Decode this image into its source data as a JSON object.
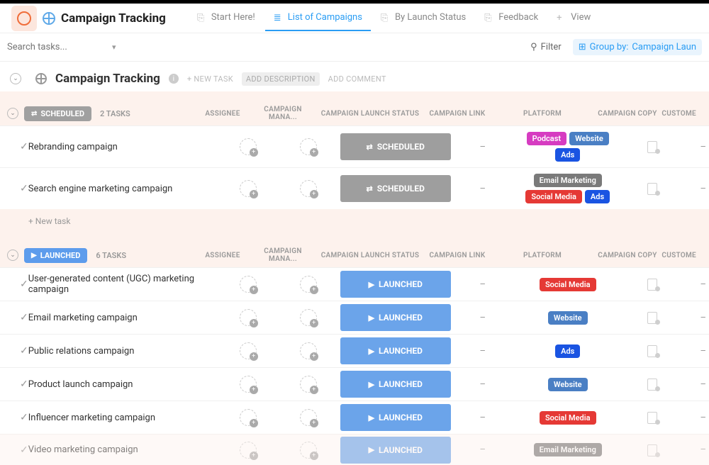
{
  "header": {
    "title": "Campaign Tracking",
    "tabs": [
      {
        "label": "Start Here!"
      },
      {
        "label": "List of Campaigns",
        "active": true
      },
      {
        "label": "By Launch Status"
      },
      {
        "label": "Feedback"
      },
      {
        "label": "View",
        "prefix": "+"
      }
    ]
  },
  "search": {
    "placeholder": "Search tasks..."
  },
  "toolbar": {
    "filter": "Filter",
    "groupByLabel": "Group by:",
    "groupByValue": "Campaign Laun"
  },
  "breadcrumb": {
    "title": "Campaign Tracking",
    "newTask": "+ NEW TASK",
    "addDesc": "ADD DESCRIPTION",
    "addComment": "ADD COMMENT"
  },
  "columns": {
    "assignee": "ASSIGNEE",
    "mana": "CAMPAIGN MANA...",
    "status": "CAMPAIGN LAUNCH STATUS",
    "link": "CAMPAIGN LINK",
    "platform": "PLATFORM",
    "copy": "CAMPAIGN COPY",
    "customer": "CUSTOME"
  },
  "groups": [
    {
      "name": "SCHEDULED",
      "class": "scheduled",
      "icon": "⇄",
      "count": "2 TASKS",
      "tasks": [
        {
          "name": "Rebranding campaign",
          "status": "SCHEDULED",
          "statusClass": "scheduled",
          "statusIcon": "⇄",
          "tags": [
            {
              "label": "Podcast",
              "cls": "t-pink"
            },
            {
              "label": "Website",
              "cls": "t-blue"
            },
            {
              "label": "Ads",
              "cls": "t-ads"
            }
          ]
        },
        {
          "name": "Search engine marketing campaign",
          "status": "SCHEDULED",
          "statusClass": "scheduled",
          "statusIcon": "⇄",
          "tags": [
            {
              "label": "Email Marketing",
              "cls": "t-grey"
            },
            {
              "label": "Social Media",
              "cls": "t-red"
            },
            {
              "label": "Ads",
              "cls": "t-ads"
            }
          ]
        }
      ],
      "newTask": "+ New task"
    },
    {
      "name": "LAUNCHED",
      "class": "launched",
      "icon": "▶",
      "count": "6 TASKS",
      "tasks": [
        {
          "name": "User-generated content (UGC) marketing campaign",
          "status": "LAUNCHED",
          "statusClass": "launched",
          "statusIcon": "▶",
          "tags": [
            {
              "label": "Social Media",
              "cls": "t-red"
            }
          ]
        },
        {
          "name": "Email marketing campaign",
          "status": "LAUNCHED",
          "statusClass": "launched",
          "statusIcon": "▶",
          "tags": [
            {
              "label": "Website",
              "cls": "t-blue"
            }
          ]
        },
        {
          "name": "Public relations campaign",
          "status": "LAUNCHED",
          "statusClass": "launched",
          "statusIcon": "▶",
          "tags": [
            {
              "label": "Ads",
              "cls": "t-ads"
            }
          ]
        },
        {
          "name": "Product launch campaign",
          "status": "LAUNCHED",
          "statusClass": "launched",
          "statusIcon": "▶",
          "tags": [
            {
              "label": "Website",
              "cls": "t-blue"
            }
          ]
        },
        {
          "name": "Influencer marketing campaign",
          "status": "LAUNCHED",
          "statusClass": "launched",
          "statusIcon": "▶",
          "tags": [
            {
              "label": "Social Media",
              "cls": "t-red"
            }
          ]
        },
        {
          "name": "Video marketing campaign",
          "status": "LAUNCHED",
          "statusClass": "launched",
          "statusIcon": "▶",
          "tags": [
            {
              "label": "Email Marketing",
              "cls": "t-grey"
            }
          ],
          "partial": true
        }
      ]
    }
  ]
}
